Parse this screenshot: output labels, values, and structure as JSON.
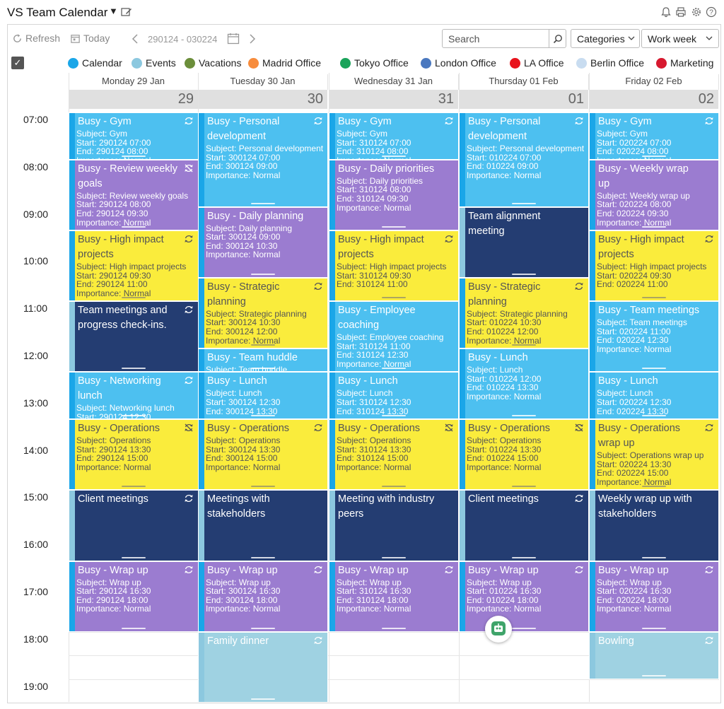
{
  "app": {
    "title": "VS Team Calendar"
  },
  "toolbar": {
    "refresh_label": "Refresh",
    "today_label": "Today",
    "date_range": "290124 - 030224",
    "search_placeholder": "Search",
    "categories_label": "Categories",
    "view_label": "Work week"
  },
  "legend": [
    {
      "label": "Calendar",
      "color": "#1aa6e8"
    },
    {
      "label": "Events",
      "color": "#8cc8df"
    },
    {
      "label": "Vacations",
      "color": "#6b8e3a"
    },
    {
      "label": "Madrid Office",
      "color": "#f78c3c"
    },
    {
      "label": "Tokyo Office",
      "color": "#1aa35a"
    },
    {
      "label": "London Office",
      "color": "#4a78bf"
    },
    {
      "label": "LA Office",
      "color": "#e8131c"
    },
    {
      "label": "Berlin Office",
      "color": "#c8dcf0"
    },
    {
      "label": "Marketing",
      "color": "#d7192f"
    }
  ],
  "days": [
    {
      "header": "Monday 29 Jan",
      "num": "29"
    },
    {
      "header": "Tuesday 30 Jan",
      "num": "30"
    },
    {
      "header": "Wednesday 31 Jan",
      "num": "31"
    },
    {
      "header": "Thursday 01 Feb",
      "num": "01"
    },
    {
      "header": "Friday 02 Feb",
      "num": "02"
    }
  ],
  "times": [
    "07:00",
    "08:00",
    "09:00",
    "10:00",
    "11:00",
    "12:00",
    "13:00",
    "14:00",
    "15:00",
    "16:00",
    "17:00",
    "18:00",
    "19:00"
  ],
  "events": [
    {
      "day": 0,
      "start": 7,
      "end": 8,
      "color": "busy-blue",
      "icon": "recurring",
      "title": "Busy - Gym",
      "body": "Subject: Gym\nStart: 290124 07:00\nEnd: 290124 08:00\nImportance: Normal"
    },
    {
      "day": 0,
      "start": 8,
      "end": 9.5,
      "color": "purple",
      "icon": "recurring-off",
      "title": "Busy - Review weekly goals",
      "body": "Subject: Review weekly goals\nStart: 290124 08:00\nEnd: 290124 09:30\nImportance: Normal"
    },
    {
      "day": 0,
      "start": 9.5,
      "end": 11,
      "color": "yellow",
      "icon": "recurring",
      "title": "Busy - High impact projects",
      "body": "Subject: High impact projects\nStart: 290124 09:30\nEnd: 290124 11:00\nImportance: Normal"
    },
    {
      "day": 0,
      "start": 11,
      "end": 12.5,
      "color": "navy",
      "icon": "recurring",
      "title": "Team meetings and progress check-ins.",
      "body": ""
    },
    {
      "day": 0,
      "start": 12.5,
      "end": 13.5,
      "color": "busy-blue",
      "icon": "recurring",
      "title": "Busy - Networking lunch",
      "body": "Subject: Networking lunch\nStart: 290124 12:30"
    },
    {
      "day": 0,
      "start": 13.5,
      "end": 15,
      "color": "yellow",
      "icon": "recurring-off",
      "title": "Busy - Operations",
      "body": "Subject: Operations\nStart: 290124 13:30\nEnd: 290124 15:00\nImportance: Normal"
    },
    {
      "day": 0,
      "start": 15,
      "end": 16.5,
      "color": "navy",
      "icon": "recurring",
      "title": "Client meetings",
      "body": ""
    },
    {
      "day": 0,
      "start": 16.5,
      "end": 18,
      "color": "purple",
      "icon": "recurring",
      "title": "Busy - Wrap up",
      "body": "Subject: Wrap up\nStart: 290124 16:30\nEnd: 290124 18:00\nImportance: Normal"
    },
    {
      "day": 1,
      "start": 7,
      "end": 9,
      "color": "busy-blue",
      "icon": "recurring",
      "title": "Busy - Personal development",
      "body": "Subject: Personal development\nStart: 300124 07:00\nEnd: 300124 09:00\nImportance: Normal"
    },
    {
      "day": 1,
      "start": 9,
      "end": 10.5,
      "color": "purple",
      "icon": "",
      "title": "Busy - Daily planning",
      "body": "Subject: Daily planning\nStart: 300124 09:00\nEnd: 300124 10:30\nImportance: Normal"
    },
    {
      "day": 1,
      "start": 10.5,
      "end": 12,
      "color": "yellow",
      "icon": "recurring",
      "title": "Busy - Strategic planning",
      "body": "Subject: Strategic planning\nStart: 300124 10:30\nEnd: 300124 12:00\nImportance: Normal"
    },
    {
      "day": 1,
      "start": 12,
      "end": 12.5,
      "color": "busy-blue",
      "icon": "",
      "title": "Busy - Team huddle",
      "body": "Subject: Team huddle"
    },
    {
      "day": 1,
      "start": 12.5,
      "end": 13.5,
      "color": "busy-blue",
      "icon": "",
      "title": "Busy - Lunch",
      "body": "Subject: Lunch\nStart: 300124 12:30\nEnd: 300124 13:30"
    },
    {
      "day": 1,
      "start": 13.5,
      "end": 15,
      "color": "yellow",
      "icon": "recurring",
      "title": "Busy - Operations",
      "body": "Subject: Operations\nStart: 300124 13:30\nEnd: 300124 15:00\nImportance: Normal"
    },
    {
      "day": 1,
      "start": 15,
      "end": 16.5,
      "color": "navy",
      "icon": "",
      "title": "Meetings with stakeholders",
      "body": ""
    },
    {
      "day": 1,
      "start": 16.5,
      "end": 18,
      "color": "purple",
      "icon": "recurring",
      "title": "Busy - Wrap up",
      "body": "Subject: Wrap up\nStart: 300124 16:30\nEnd: 300124 18:00\nImportance: Normal"
    },
    {
      "day": 1,
      "start": 18,
      "end": 19.5,
      "color": "light",
      "icon": "recurring",
      "title": "Family dinner",
      "body": ""
    },
    {
      "day": 2,
      "start": 7,
      "end": 8,
      "color": "busy-blue",
      "icon": "recurring",
      "title": "Busy - Gym",
      "body": "Subject: Gym\nStart: 310124 07:00\nEnd: 310124 08:00\nImportance: Normal"
    },
    {
      "day": 2,
      "start": 8,
      "end": 9.5,
      "color": "purple",
      "icon": "",
      "title": "Busy - Daily priorities",
      "body": "Subject: Daily priorities\nStart: 310124 08:00\nEnd: 310124 09:30\nImportance: Normal"
    },
    {
      "day": 2,
      "start": 9.5,
      "end": 11,
      "color": "yellow",
      "icon": "recurring",
      "title": "Busy - High impact projects",
      "body": "Subject: High impact projects\nStart: 310124 09:30\nEnd: 310124 11:00"
    },
    {
      "day": 2,
      "start": 11,
      "end": 12.5,
      "color": "busy-blue",
      "icon": "",
      "title": "Busy - Employee coaching",
      "body": "Subject: Employee coaching\nStart: 310124 11:00\nEnd: 310124 12:30\nImportance: Normal"
    },
    {
      "day": 2,
      "start": 12.5,
      "end": 13.5,
      "color": "busy-blue",
      "icon": "",
      "title": "Busy - Lunch",
      "body": "Subject: Lunch\nStart: 310124 12:30\nEnd: 310124 13:30"
    },
    {
      "day": 2,
      "start": 13.5,
      "end": 15,
      "color": "yellow",
      "icon": "recurring-off",
      "title": "Busy - Operations",
      "body": "Subject: Operations\nStart: 310124 13:30\nEnd: 310124 15:00\nImportance: Normal"
    },
    {
      "day": 2,
      "start": 15,
      "end": 16.5,
      "color": "navy",
      "icon": "",
      "title": "Meeting with industry peers",
      "body": ""
    },
    {
      "day": 2,
      "start": 16.5,
      "end": 18,
      "color": "purple",
      "icon": "recurring",
      "title": "Busy - Wrap up",
      "body": "Subject: Wrap up\nStart: 310124 16:30\nEnd: 310124 18:00\nImportance: Normal"
    },
    {
      "day": 3,
      "start": 7,
      "end": 9,
      "color": "busy-blue",
      "icon": "recurring",
      "title": "Busy - Personal development",
      "body": "Subject: Personal development\nStart: 010224 07:00\nEnd: 010224 09:00\nImportance: Normal"
    },
    {
      "day": 3,
      "start": 9,
      "end": 10.5,
      "color": "navy",
      "icon": "",
      "title": "Team alignment meeting",
      "body": ""
    },
    {
      "day": 3,
      "start": 10.5,
      "end": 12,
      "color": "yellow",
      "icon": "recurring",
      "title": "Busy - Strategic planning",
      "body": "Subject: Strategic planning\nStart: 010224 10:30\nEnd: 010224 12:00\nImportance: Normal"
    },
    {
      "day": 3,
      "start": 12,
      "end": 13.5,
      "color": "busy-blue",
      "icon": "",
      "title": "Busy - Lunch",
      "body": "Subject: Lunch\nStart: 010224 12:00\nEnd: 010224 13:30\nImportance: Normal"
    },
    {
      "day": 3,
      "start": 13.5,
      "end": 15,
      "color": "yellow",
      "icon": "recurring-off",
      "title": "Busy - Operations",
      "body": "Subject: Operations\nStart: 010224 13:30\nEnd: 010224 15:00\nImportance: Normal"
    },
    {
      "day": 3,
      "start": 15,
      "end": 16.5,
      "color": "navy",
      "icon": "recurring",
      "title": "Client meetings",
      "body": ""
    },
    {
      "day": 3,
      "start": 16.5,
      "end": 18,
      "color": "purple",
      "icon": "recurring",
      "title": "Busy - Wrap up",
      "body": "Subject: Wrap up\nStart: 010224 16:30\nEnd: 010224 18:00\nImportance: Normal"
    },
    {
      "day": 4,
      "start": 7,
      "end": 8,
      "color": "busy-blue",
      "icon": "recurring",
      "title": "Busy - Gym",
      "body": "Subject: Gym\nStart: 020224 07:00\nEnd: 020224 08:00\nImportance: Normal"
    },
    {
      "day": 4,
      "start": 8,
      "end": 9.5,
      "color": "purple",
      "icon": "",
      "title": "Busy - Weekly wrap up",
      "body": "Subject: Weekly wrap up\nStart: 020224 08:00\nEnd: 020224 09:30\nImportance: Normal"
    },
    {
      "day": 4,
      "start": 9.5,
      "end": 11,
      "color": "yellow",
      "icon": "recurring",
      "title": "Busy - High impact projects",
      "body": "Subject: High impact projects\nStart: 020224 09:30\nEnd: 020224 11:00"
    },
    {
      "day": 4,
      "start": 11,
      "end": 12.5,
      "color": "busy-blue",
      "icon": "",
      "title": "Busy - Team meetings",
      "body": "Subject: Team meetings\nStart: 020224 11:00\nEnd: 020224 12:30\nImportance: Normal"
    },
    {
      "day": 4,
      "start": 12.5,
      "end": 13.5,
      "color": "busy-blue",
      "icon": "",
      "title": "Busy - Lunch",
      "body": "Subject: Lunch\nStart: 020224 12:30\nEnd: 020224 13:30"
    },
    {
      "day": 4,
      "start": 13.5,
      "end": 15,
      "color": "yellow",
      "icon": "recurring",
      "title": "Busy - Operations wrap up",
      "body": "Subject: Operations wrap up\nStart: 020224 13:30\nEnd: 020224 15:00\nImportance: Normal"
    },
    {
      "day": 4,
      "start": 15,
      "end": 16.5,
      "color": "navy",
      "icon": "",
      "title": "Weekly wrap up with stakeholders",
      "body": ""
    },
    {
      "day": 4,
      "start": 16.5,
      "end": 18,
      "color": "purple",
      "icon": "recurring",
      "title": "Busy - Wrap up",
      "body": "Subject: Wrap up\nStart: 020224 16:30\nEnd: 020224 18:00\nImportance: Normal"
    },
    {
      "day": 4,
      "start": 18,
      "end": 19,
      "color": "light",
      "icon": "recurring",
      "title": "Bowling",
      "body": ""
    }
  ]
}
